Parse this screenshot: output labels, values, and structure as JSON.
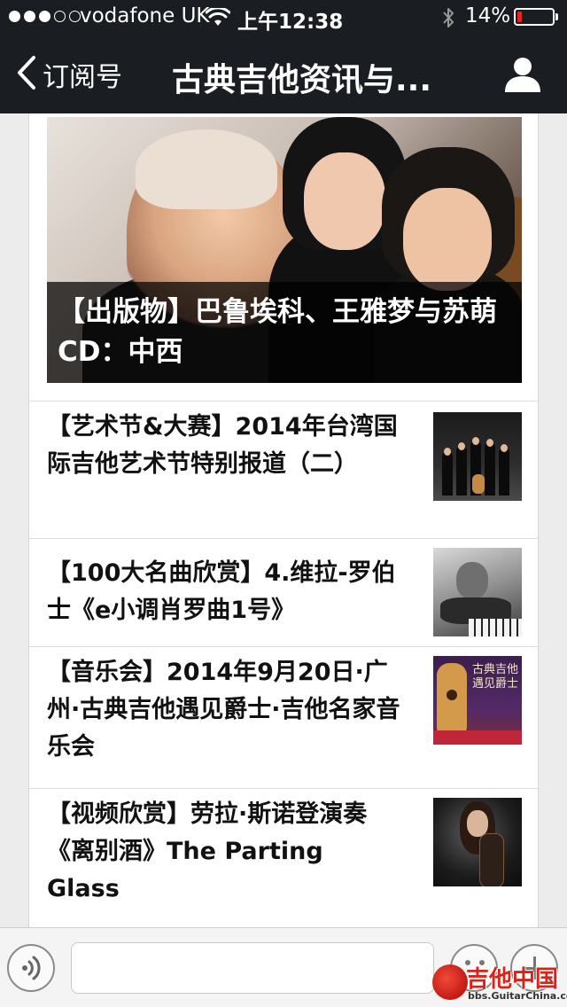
{
  "status_bar": {
    "carrier": "vodafone UK",
    "time": "上午12:38",
    "battery_percent": "14%",
    "battery_level": 0.14,
    "signal_bars_filled": 3,
    "signal_bars_total": 5
  },
  "nav": {
    "back_label": "订阅号",
    "title": "古典吉他资讯与..."
  },
  "hero": {
    "caption": "【出版物】巴鲁埃科、王雅梦与苏萌CD：中西"
  },
  "articles": [
    {
      "title": "【艺术节&大赛】2014年台湾国际吉他艺术节特别报道（二）"
    },
    {
      "title": "【100大名曲欣赏】4.维拉-罗伯士《e小调肖罗曲1号》"
    },
    {
      "title": "【音乐会】2014年9月20日·广州·古典吉他遇见爵士·吉他名家音乐会"
    },
    {
      "title": "【视频欣赏】劳拉·斯诺登演奏《离别酒》The Parting Glass"
    }
  ],
  "thumbnail_text": {
    "concert_poster": "古典吉他遇见爵士"
  },
  "watermark": {
    "title": "吉他中国",
    "url": "bbs.GuitarChina.com"
  },
  "colors": {
    "bar_background": "#1a1d22",
    "battery_low": "#e8231b",
    "watermark_red": "#d8231a"
  }
}
